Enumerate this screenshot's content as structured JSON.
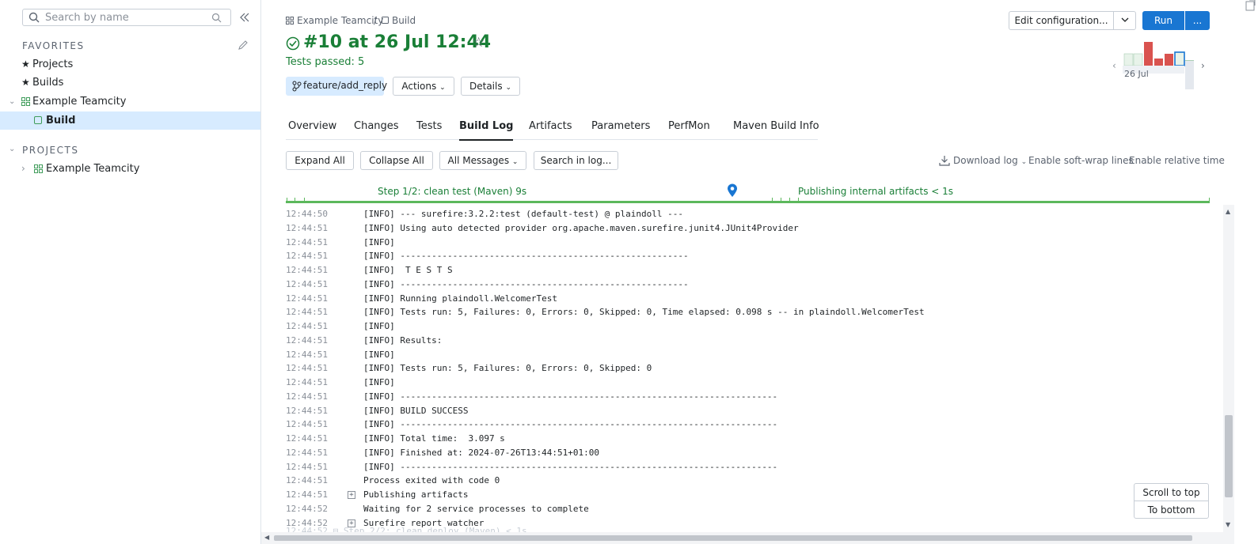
{
  "sidebar": {
    "search_placeholder": "Search by name",
    "favorites_title": "FAVORITES",
    "favorites": [
      "Projects",
      "Builds"
    ],
    "project_node": "Example Teamcity",
    "build_node": "Build",
    "projects_title": "PROJECTS",
    "projects": [
      "Example Teamcity"
    ]
  },
  "header": {
    "breadcrumb_project": "Example Teamcity",
    "breadcrumb_sep": "/",
    "breadcrumb_build": "Build",
    "title": "#10 at 26 Jul 12:44",
    "status": "Tests passed: 5",
    "branch": "feature/add_reply",
    "actions": "Actions",
    "details": "Details",
    "edit_config": "Edit configuration...",
    "run": "Run",
    "more": "...",
    "chart_date": "26 Jul"
  },
  "tabs": [
    "Overview",
    "Changes",
    "Tests",
    "Build Log",
    "Artifacts",
    "Parameters",
    "PerfMon",
    "Maven Build Info"
  ],
  "toolbar": {
    "expand_all": "Expand All",
    "collapse_all": "Collapse All",
    "all_messages": "All Messages",
    "search_log": "Search in log...",
    "download_log": "Download log",
    "soft_wrap": "Enable soft-wrap lines",
    "relative_time": "Enable relative time"
  },
  "timeline": {
    "step1": "Step 1/2: clean test (Maven) 9s",
    "publishing": "Publishing internal artifacts < 1s"
  },
  "log": [
    {
      "t": "12:44:50",
      "m": "[INFO] --- surefire:3.2.2:test (default-test) @ plaindoll ---"
    },
    {
      "t": "12:44:51",
      "m": "[INFO] Using auto detected provider org.apache.maven.surefire.junit4.JUnit4Provider"
    },
    {
      "t": "12:44:51",
      "m": "[INFO]"
    },
    {
      "t": "12:44:51",
      "m": "[INFO] -------------------------------------------------------"
    },
    {
      "t": "12:44:51",
      "m": "[INFO]  T E S T S"
    },
    {
      "t": "12:44:51",
      "m": "[INFO] -------------------------------------------------------"
    },
    {
      "t": "12:44:51",
      "m": "[INFO] Running plaindoll.WelcomerTest"
    },
    {
      "t": "12:44:51",
      "m": "[INFO] Tests run: 5, Failures: 0, Errors: 0, Skipped: 0, Time elapsed: 0.098 s -- in plaindoll.WelcomerTest"
    },
    {
      "t": "12:44:51",
      "m": "[INFO]"
    },
    {
      "t": "12:44:51",
      "m": "[INFO] Results:"
    },
    {
      "t": "12:44:51",
      "m": "[INFO]"
    },
    {
      "t": "12:44:51",
      "m": "[INFO] Tests run: 5, Failures: 0, Errors: 0, Skipped: 0"
    },
    {
      "t": "12:44:51",
      "m": "[INFO]"
    },
    {
      "t": "12:44:51",
      "m": "[INFO] ------------------------------------------------------------------------"
    },
    {
      "t": "12:44:51",
      "m": "[INFO] BUILD SUCCESS"
    },
    {
      "t": "12:44:51",
      "m": "[INFO] ------------------------------------------------------------------------"
    },
    {
      "t": "12:44:51",
      "m": "[INFO] Total time:  3.097 s"
    },
    {
      "t": "12:44:51",
      "m": "[INFO] Finished at: 2024-07-26T13:44:51+01:00"
    },
    {
      "t": "12:44:51",
      "m": "[INFO] ------------------------------------------------------------------------"
    },
    {
      "t": "12:44:51",
      "m": "Process exited with code 0"
    },
    {
      "t": "12:44:51",
      "m": "Publishing artifacts",
      "expandable": true
    },
    {
      "t": "12:44:52",
      "m": "Waiting for 2 service processes to complete"
    },
    {
      "t": "12:44:52",
      "m": "Surefire report watcher",
      "expandable": true
    }
  ],
  "scroll": {
    "to_top": "Scroll to top",
    "to_bottom": "To bottom"
  },
  "colors": {
    "accent": "#1976d2",
    "success": "#1a7f37",
    "fail_bar": "#d9534f",
    "selected_bg": "#d7ebff"
  }
}
